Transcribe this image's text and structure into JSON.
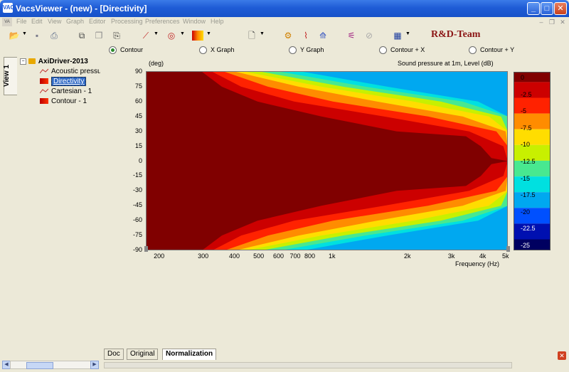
{
  "window": {
    "title": "VacsViewer - (new) - [Directivity]",
    "app_icon": "VACS"
  },
  "menu": [
    "File",
    "Edit",
    "View",
    "Graph",
    "Editor",
    "Processing",
    "Preferences",
    "Window",
    "Help"
  ],
  "branding": {
    "label": "R&D-Team"
  },
  "view_modes": [
    {
      "label": "Contour",
      "selected": true
    },
    {
      "label": "X Graph",
      "selected": false
    },
    {
      "label": "Y Graph",
      "selected": false
    },
    {
      "label": "Contour + X",
      "selected": false
    },
    {
      "label": "Contour + Y",
      "selected": false
    }
  ],
  "side_tab": {
    "label": "View 1"
  },
  "tree": {
    "root": "AxiDriver-2013",
    "children": [
      {
        "label": "Acoustic pressure",
        "icon": "line-chart-icon"
      },
      {
        "label": "Directivity",
        "icon": "contour-icon",
        "selected": true
      },
      {
        "label": "Cartesian - 1",
        "icon": "line-chart-icon"
      },
      {
        "label": "Contour - 1",
        "icon": "contour-icon"
      }
    ]
  },
  "chart_data": {
    "type": "heatmap",
    "title": "Sound pressure at 1m, Level  (dB)",
    "ylabel": "(deg)",
    "xlabel": "Frequency  (Hz)",
    "x_scale": "log",
    "xlim": [
      180,
      5000
    ],
    "ylim": [
      -90,
      90
    ],
    "x_ticks": [
      "200",
      "300",
      "400",
      "500",
      "600",
      "700",
      "800",
      "1k",
      "2k",
      "3k",
      "4k",
      "5k"
    ],
    "x_tick_values": [
      200,
      300,
      400,
      500,
      600,
      700,
      800,
      1000,
      2000,
      3000,
      4000,
      5000
    ],
    "y_ticks": [
      90,
      75,
      60,
      45,
      30,
      15,
      0,
      -15,
      -30,
      -45,
      -60,
      -75,
      -90
    ],
    "colorbar": {
      "levels": [
        0,
        -2.5,
        -5,
        -7.5,
        -10,
        -12.5,
        -15,
        -17.5,
        -20,
        -22.5,
        -25
      ],
      "level_labels": [
        "0",
        "-2.5",
        "-5",
        "-7.5",
        "-10",
        "-12.5",
        "-15",
        "-17.5",
        "-20",
        "-22.5",
        "-25"
      ],
      "colors": [
        "#800000",
        "#cc0000",
        "#ff2200",
        "#ff8c00",
        "#ffdd00",
        "#c8f000",
        "#48e890",
        "#00e0e0",
        "#00a8f0",
        "#0050ff",
        "#0010b0",
        "#000060"
      ]
    },
    "contour_boundary_freq_hz": {
      "angles_deg": [
        0,
        15,
        30,
        45,
        60,
        75,
        90
      ],
      "m2_5": [
        5000,
        4800,
        3500,
        1600,
        700,
        430,
        330
      ],
      "m5": [
        5000,
        5000,
        4500,
        2400,
        1000,
        550,
        370
      ],
      "m7_5": [
        5000,
        5000,
        4900,
        3300,
        1500,
        730,
        410
      ],
      "m10": [
        5000,
        5000,
        5000,
        4200,
        2100,
        900,
        450
      ],
      "m12_5": [
        5000,
        5000,
        5000,
        4700,
        2700,
        1100,
        520
      ],
      "m15": [
        5000,
        5000,
        5000,
        5000,
        3300,
        1350,
        620
      ],
      "m17_5": [
        5000,
        5000,
        5000,
        5000,
        3800,
        1650,
        760
      ],
      "m20": [
        5000,
        5000,
        5000,
        5000,
        4300,
        2000,
        950
      ]
    }
  },
  "bottom_tabs": [
    {
      "label": "Doc",
      "active": false
    },
    {
      "label": "Original",
      "active": false
    },
    {
      "label": "Normalization",
      "active": true
    }
  ]
}
